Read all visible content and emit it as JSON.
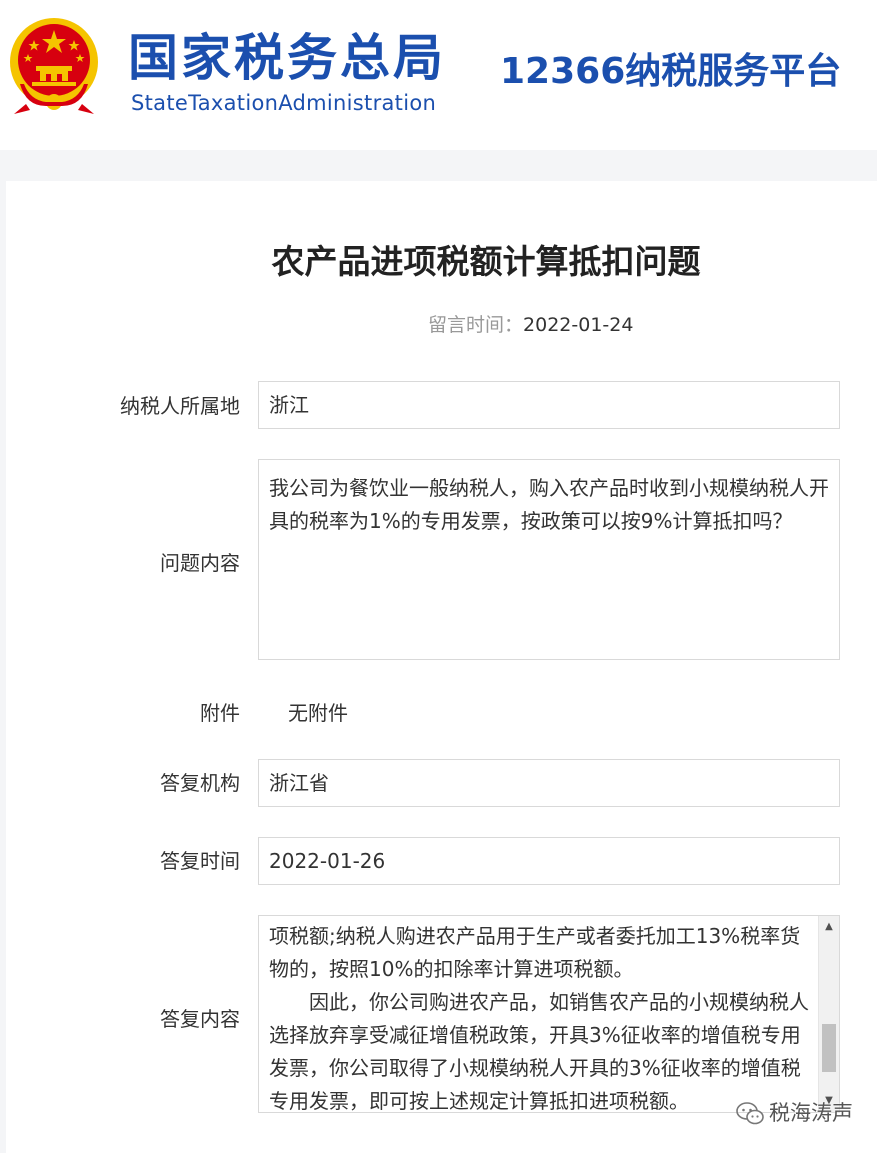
{
  "header": {
    "brand_cn": "国家税务总局",
    "brand_en": "StateTaxationAdministration",
    "platform": "12366纳税服务平台",
    "emblem_icon": "national-emblem-icon"
  },
  "article": {
    "title": "农产品进项税额计算抵扣问题",
    "date_label": "留言时间：",
    "date_value": "2022-01-24"
  },
  "fields": {
    "location_label": "纳税人所属地",
    "location_value": "浙江",
    "question_label": "问题内容",
    "question_value": "我公司为餐饮业一般纳税人，购入农产品时收到小规模纳税人开具的税率为1%的专用发票，按政策可以按9%计算抵扣吗？",
    "attachment_label": "附件",
    "attachment_value": "无附件",
    "org_label": "答复机构",
    "org_value": "浙江省",
    "reply_time_label": "答复时间",
    "reply_time_value": "2022-01-26",
    "reply_label": "答复内容",
    "reply_para1": "项税额;纳税人购进农产品用于生产或者委托加工13%税率货物的，按照10%的扣除率计算进项税额。",
    "reply_para2": "因此，你公司购进农产品，如销售农产品的小规模纳税人选择放弃享受减征增值税政策，开具3%征收率的增值税专用发票，你公司取得了小规模纳税人开具的3%征收率的增值税专用发票，即可按上述规定计算抵扣进项税额。"
  },
  "watermark": {
    "text": "税海涛声",
    "icon": "wechat-icon"
  },
  "colors": {
    "brand_blue": "#1b4fae",
    "emblem_red": "#d7000f",
    "emblem_gold": "#f5c400",
    "border": "#d9d9d9",
    "page_bg": "#f4f5f7"
  }
}
